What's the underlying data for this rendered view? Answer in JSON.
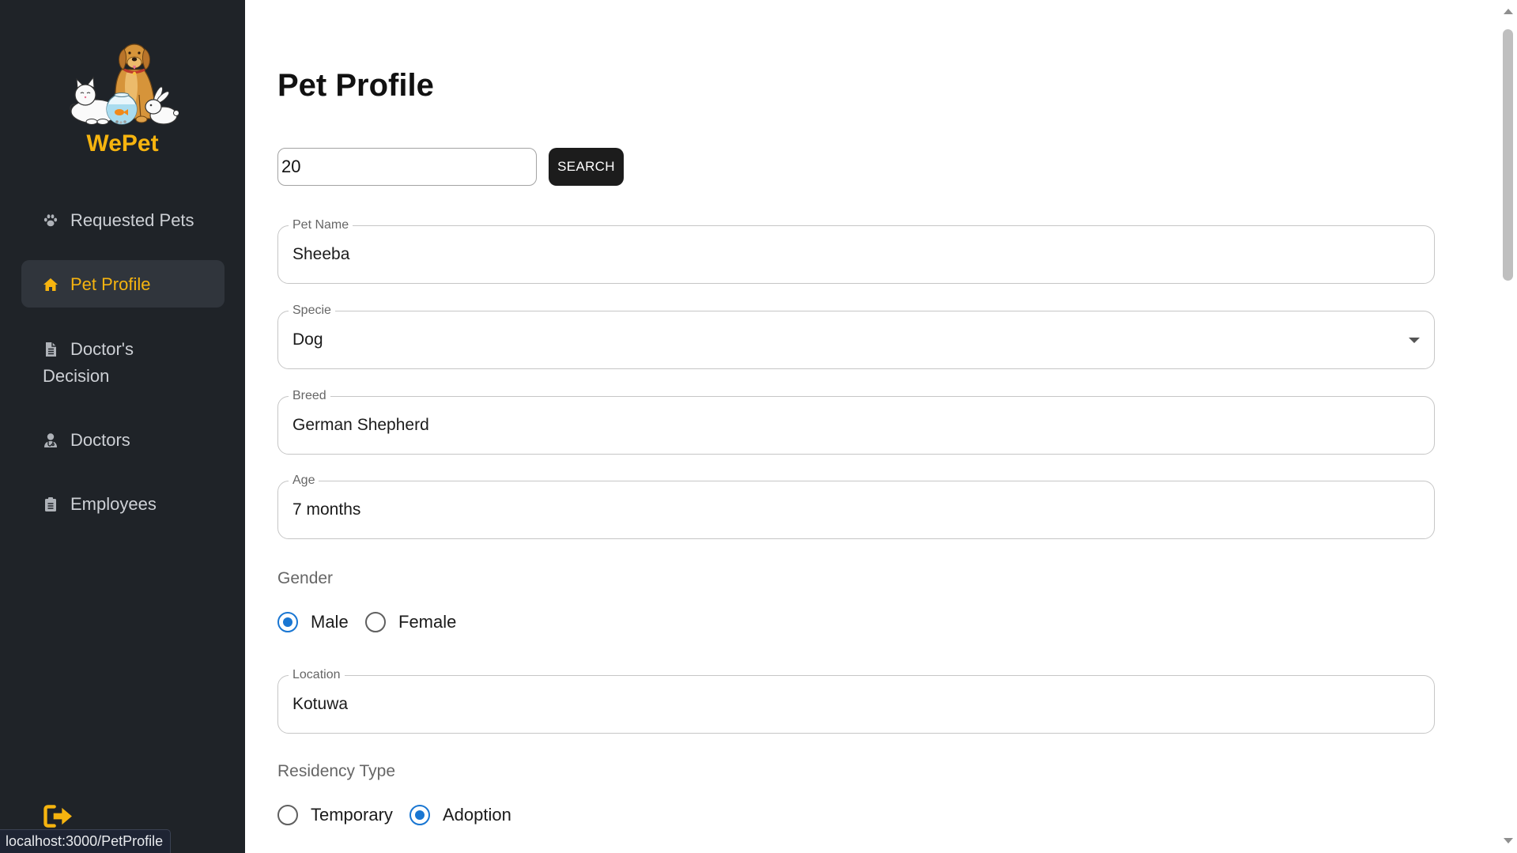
{
  "theme": {
    "accent": "#f6b40f",
    "sidebar_bg": "#1f2328",
    "sidebar_active_bg": "#30353c",
    "radio_checked": "#1976d2",
    "button_bg": "#1c1c1c"
  },
  "brand": {
    "name": "WePet"
  },
  "sidebar": {
    "items": [
      {
        "label": "Requested Pets",
        "icon": "paw-icon",
        "active": false
      },
      {
        "label": "Pet Profile",
        "icon": "home-icon",
        "active": true
      },
      {
        "label": "Doctor's Decision",
        "icon": "document-icon",
        "active": false
      },
      {
        "label": "Doctors",
        "icon": "doctor-icon",
        "active": false
      },
      {
        "label": "Employees",
        "icon": "clipboard-icon",
        "active": false
      }
    ],
    "logout_icon": "logout-icon"
  },
  "page": {
    "title": "Pet Profile"
  },
  "search": {
    "value": "20",
    "button_label": "SEARCH"
  },
  "form": {
    "pet_name": {
      "label": "Pet Name",
      "value": "Sheeba"
    },
    "specie": {
      "label": "Specie",
      "value": "Dog"
    },
    "breed": {
      "label": "Breed",
      "value": "German Shepherd"
    },
    "age": {
      "label": "Age",
      "value": "7 months"
    },
    "gender": {
      "label": "Gender",
      "options": [
        "Male",
        "Female"
      ],
      "selected": "Male"
    },
    "location": {
      "label": "Location",
      "value": "Kotuwa"
    },
    "residency_type": {
      "label": "Residency Type",
      "options": [
        "Temporary",
        "Adoption"
      ],
      "selected": "Adoption"
    }
  },
  "status_bar": {
    "url": "localhost:3000/PetProfile"
  }
}
